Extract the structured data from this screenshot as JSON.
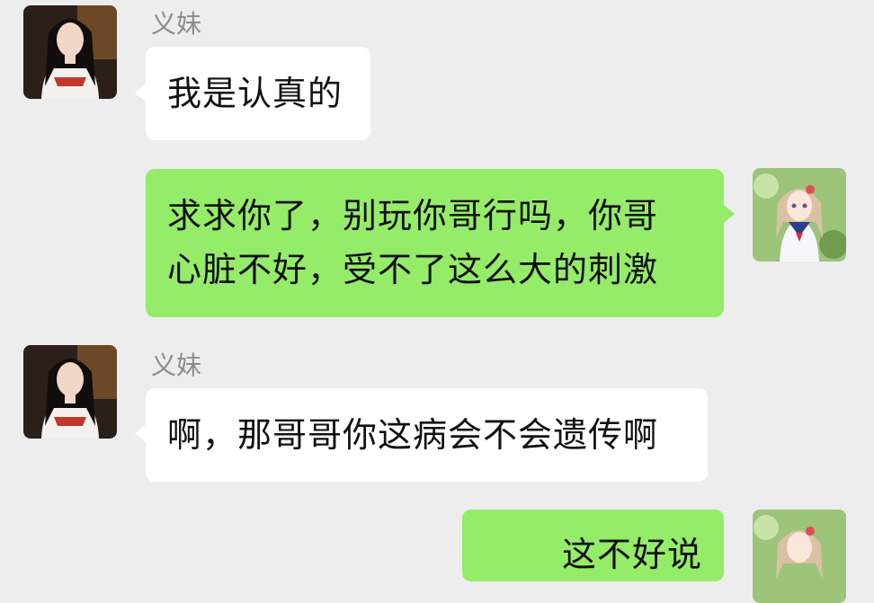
{
  "colors": {
    "background": "#ededed",
    "received_bubble": "#ffffff",
    "sent_bubble": "#95ec69",
    "sender_name": "#8c8c8c"
  },
  "messages": [
    {
      "direction": "received",
      "sender": "义妹",
      "text": "我是认真的",
      "avatar": "girl-avatar-icon"
    },
    {
      "direction": "sent",
      "lines": [
        "求求你了，别玩你哥行吗，你哥",
        "心脏不好，受不了这么大的刺激"
      ],
      "avatar": "anime-girl-avatar-icon"
    },
    {
      "direction": "received",
      "sender": "义妹",
      "text": "啊，那哥哥你这病会不会遗传啊",
      "avatar": "girl-avatar-icon"
    },
    {
      "direction": "sent",
      "text": "这不好说",
      "avatar": "anime-girl-avatar-icon"
    }
  ]
}
